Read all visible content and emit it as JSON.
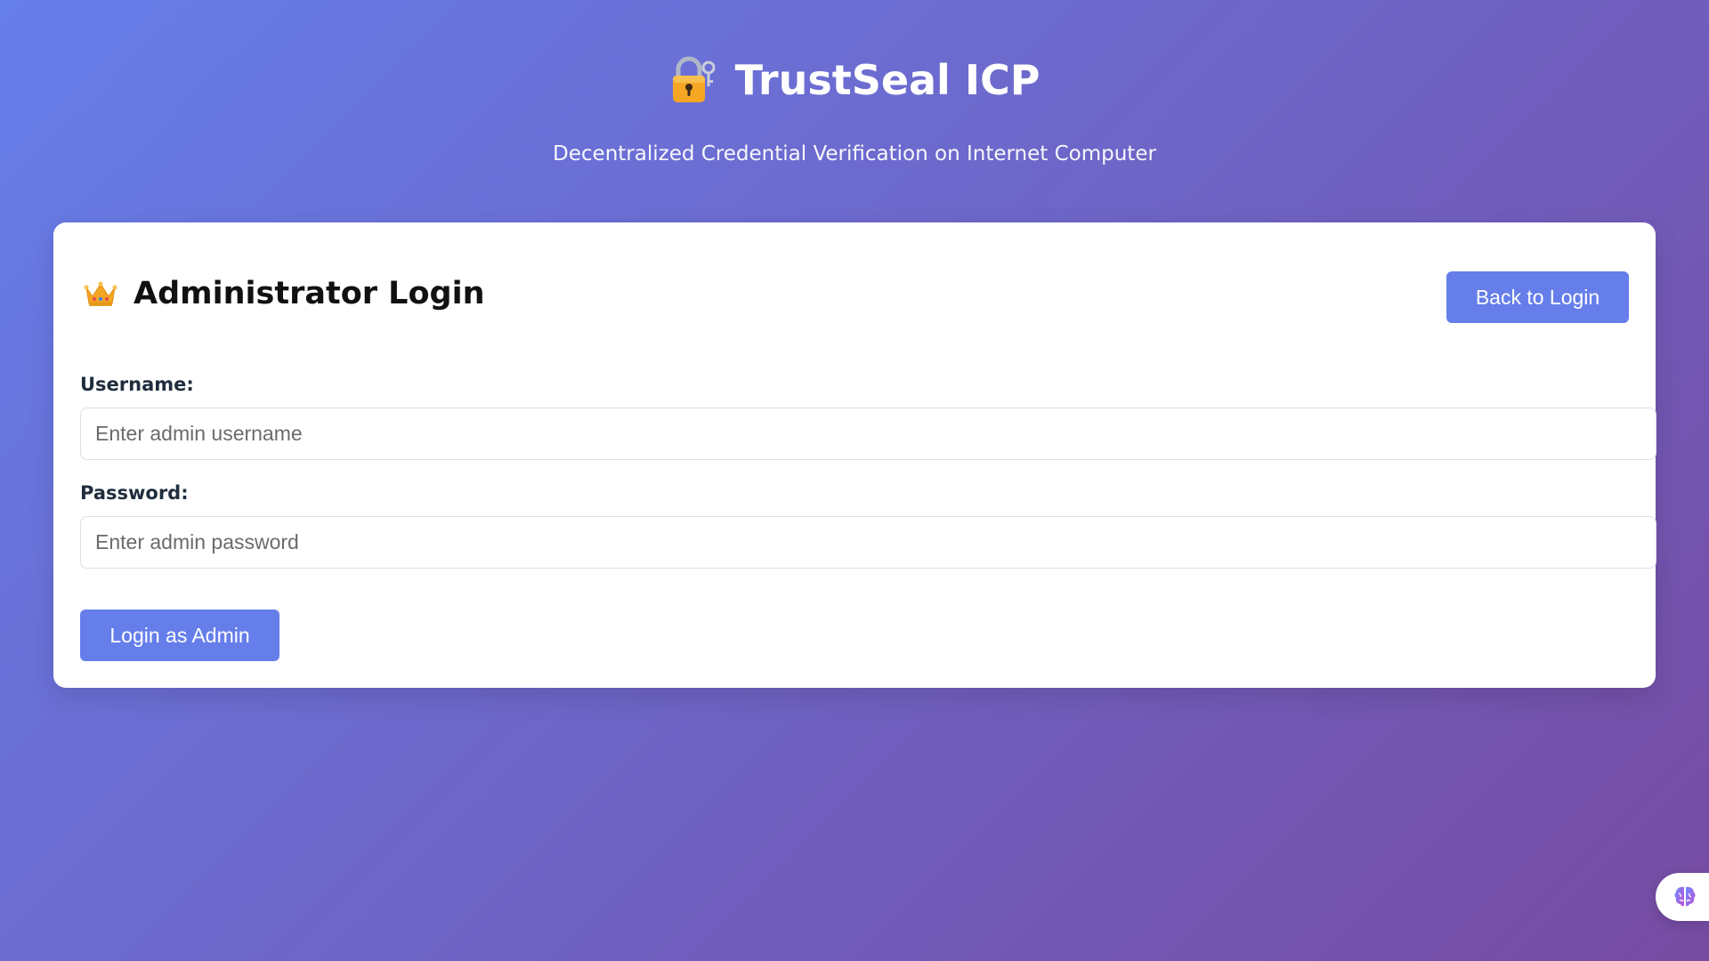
{
  "app": {
    "title": "TrustSeal ICP",
    "subtitle": "Decentralized Credential Verification on Internet Computer",
    "title_icon": "lock-with-key-icon"
  },
  "card": {
    "title": "Administrator Login",
    "title_icon": "crown-icon",
    "back_button_label": "Back to Login",
    "username": {
      "label": "Username:",
      "value": "",
      "placeholder": "Enter admin username"
    },
    "password": {
      "label": "Password:",
      "value": "",
      "placeholder": "Enter admin password"
    },
    "submit_label": "Login as Admin"
  },
  "widget": {
    "icon": "brain-icon"
  },
  "colors": {
    "gradient_start": "#667eea",
    "gradient_end": "#764ba2",
    "accent": "#667eea",
    "card_background": "#ffffff"
  }
}
